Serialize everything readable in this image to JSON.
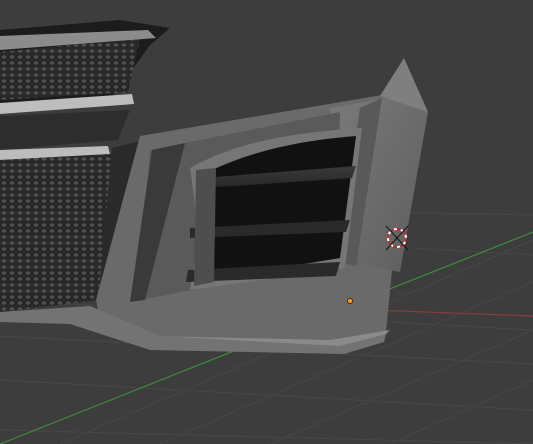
{
  "viewport": {
    "mode": "3d-viewport",
    "background_color": "#3d3d3d",
    "grid_color": "#474747",
    "x_axis_color": "#8a3c3c",
    "y_axis_color": "#3f8a3f",
    "model_primary_color": "#6d6d6d",
    "model_dark_color": "#2b2b2b",
    "mesh_grille_color": "#4a4a4a",
    "origin_color": "#ff9a1f",
    "cursor_ring_color_a": "#cc2222",
    "cursor_ring_color_b": "#ffffff",
    "objects": [
      {
        "name": "front-bumper-mesh",
        "selected": false
      },
      {
        "name": "upper-grille-mesh",
        "selected": false
      }
    ]
  }
}
